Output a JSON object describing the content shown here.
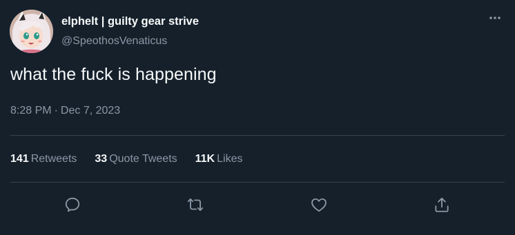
{
  "user": {
    "display_name": "elphelt | guilty gear strive",
    "handle": "@SpeothosVenaticus"
  },
  "tweet": {
    "text": "what the fuck is happening",
    "time": "8:28 PM",
    "separator": "·",
    "date": "Dec 7, 2023"
  },
  "stats": {
    "retweets_count": "141",
    "retweets_label": "Retweets",
    "quotes_count": "33",
    "quotes_label": "Quote Tweets",
    "likes_count": "11K",
    "likes_label": "Likes"
  },
  "actions": [
    "reply-icon",
    "retweet-icon",
    "like-icon",
    "share-icon"
  ],
  "colors": {
    "background": "#15202b",
    "primary_text": "#f7f9f9",
    "secondary_text": "#8b98a5",
    "divider": "#38444d"
  }
}
